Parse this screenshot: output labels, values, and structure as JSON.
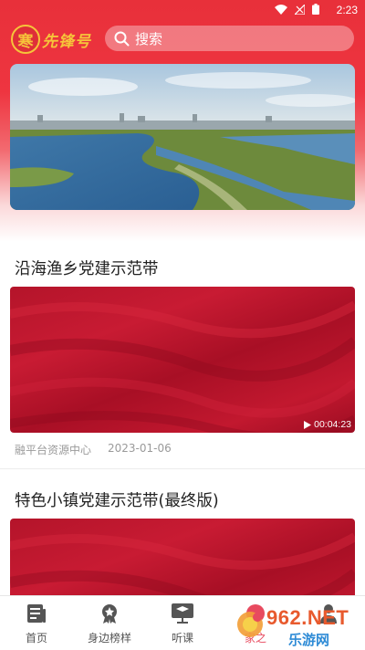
{
  "status_bar": {
    "time": "2:23",
    "icons": [
      "wifi-icon",
      "signal-icon",
      "battery-icon"
    ]
  },
  "header": {
    "logo_badge": "寒",
    "logo_text": "先锋号",
    "search_placeholder": "搜索"
  },
  "banner": {
    "image": "aerial-lake-landscape"
  },
  "articles": [
    {
      "title": "沿海渔乡党建示范带",
      "duration": "00:04:23",
      "source": "融平台资源中心",
      "date": "2023-01-06"
    },
    {
      "title": "特色小镇党建示范带(最终版)"
    }
  ],
  "bottom_nav": {
    "items": [
      {
        "label": "首页",
        "icon": "news-icon"
      },
      {
        "label": "身边榜样",
        "icon": "badge-icon"
      },
      {
        "label": "听课",
        "icon": "lecture-icon"
      },
      {
        "label": "家之",
        "icon": "home-icon"
      },
      {
        "label": "",
        "icon": "user-icon"
      }
    ]
  },
  "watermark": {
    "brand": "962.NET",
    "subtitle": "乐游网"
  },
  "colors": {
    "header_red": "#e8303a",
    "logo_gold": "#f6c43a",
    "video_red": "#b4142a"
  }
}
